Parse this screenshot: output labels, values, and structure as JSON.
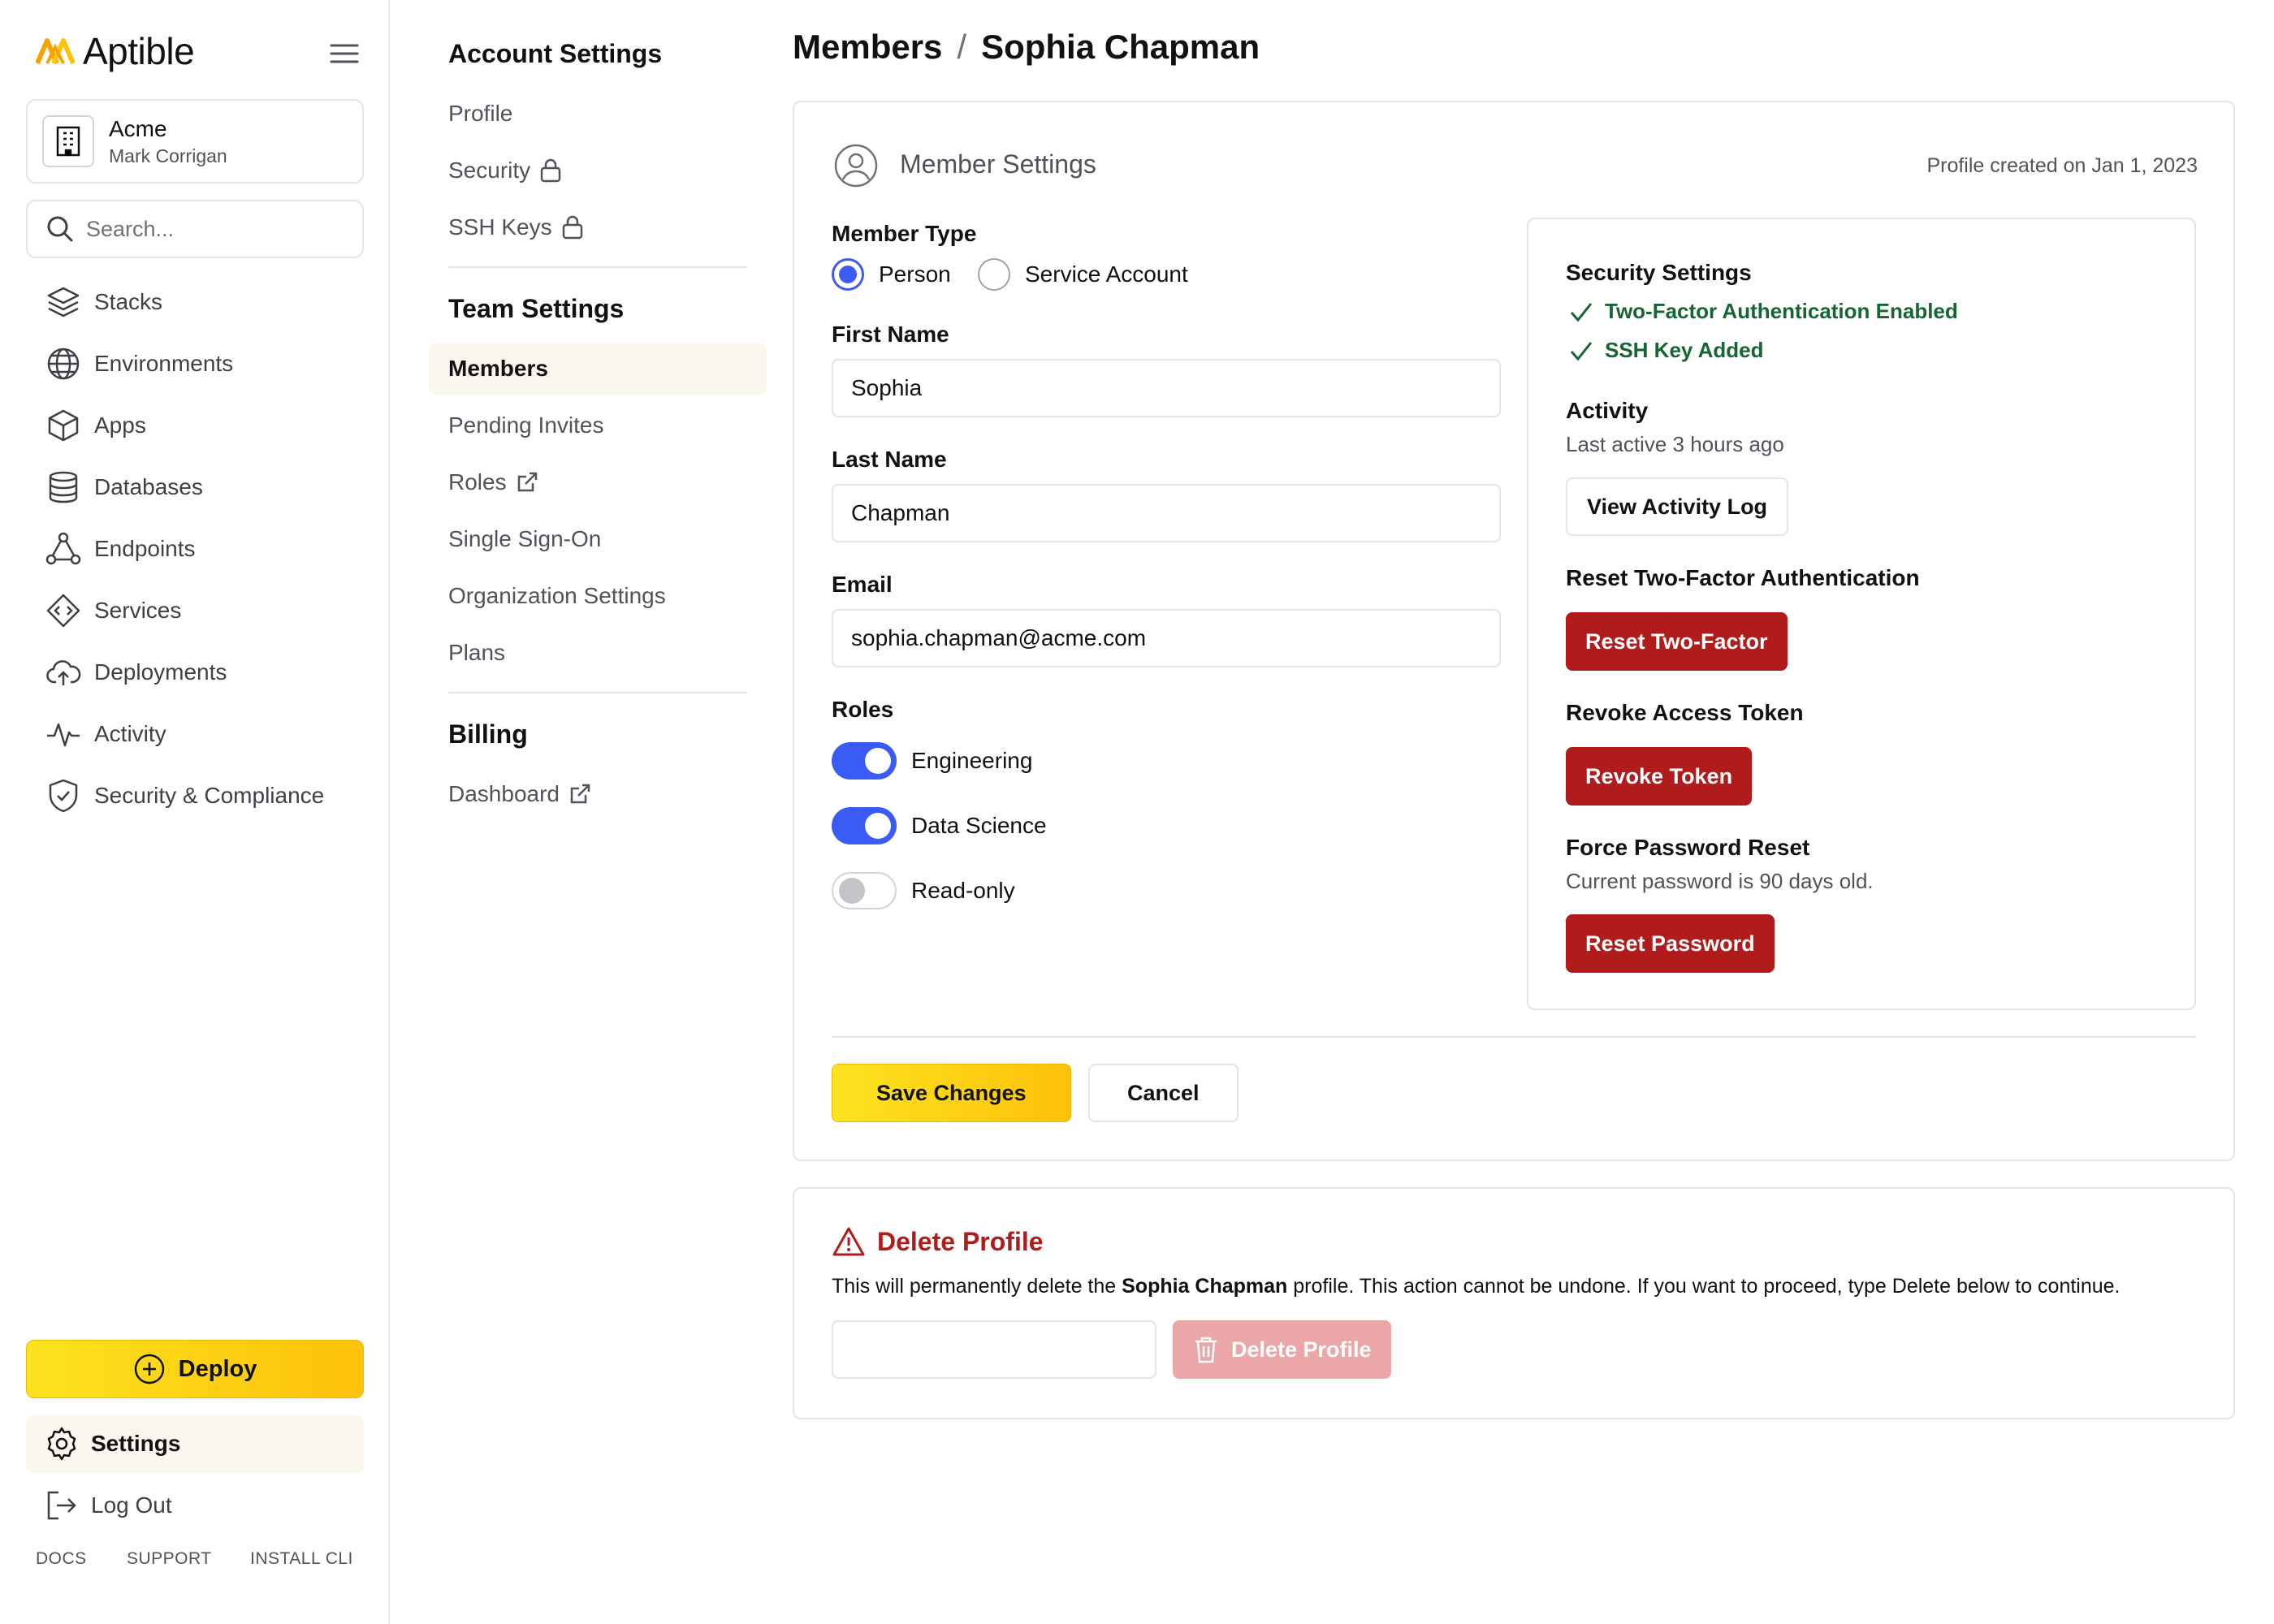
{
  "brand": {
    "name": "Aptible",
    "accent": "#fdc10a",
    "logo_icon": "aptible-chevrons-icon"
  },
  "org": {
    "name": "Acme",
    "user": "Mark Corrigan"
  },
  "search": {
    "placeholder": "Search..."
  },
  "sidebar": {
    "items": [
      {
        "label": "Stacks",
        "icon": "layers-icon"
      },
      {
        "label": "Environments",
        "icon": "globe-icon"
      },
      {
        "label": "Apps",
        "icon": "cube-icon"
      },
      {
        "label": "Databases",
        "icon": "database-icon"
      },
      {
        "label": "Endpoints",
        "icon": "endpoints-icon"
      },
      {
        "label": "Services",
        "icon": "code-diamond-icon"
      },
      {
        "label": "Deployments",
        "icon": "cloud-upload-icon"
      },
      {
        "label": "Activity",
        "icon": "pulse-icon"
      },
      {
        "label": "Security & Compliance",
        "icon": "shield-check-icon"
      }
    ],
    "deploy_label": "Deploy",
    "settings_label": "Settings",
    "logout_label": "Log Out",
    "footer": [
      "DOCS",
      "SUPPORT",
      "INSTALL CLI"
    ]
  },
  "settings_nav": {
    "account_title": "Account Settings",
    "account_items": [
      {
        "label": "Profile"
      },
      {
        "label": "Security",
        "icon": "lock-icon"
      },
      {
        "label": "SSH Keys",
        "icon": "lock-icon"
      }
    ],
    "team_title": "Team Settings",
    "team_items": [
      {
        "label": "Members",
        "active": true
      },
      {
        "label": "Pending Invites"
      },
      {
        "label": "Roles",
        "icon": "external-link-icon"
      },
      {
        "label": "Single Sign-On"
      },
      {
        "label": "Organization Settings"
      },
      {
        "label": "Plans"
      }
    ],
    "billing_title": "Billing",
    "billing_items": [
      {
        "label": "Dashboard",
        "icon": "external-link-icon"
      }
    ]
  },
  "breadcrumb": {
    "parent": "Members",
    "separator": "/",
    "current": "Sophia Chapman"
  },
  "member_settings": {
    "title": "Member Settings",
    "created": "Profile created on Jan 1, 2023",
    "member_type_label": "Member Type",
    "member_type_options": [
      "Person",
      "Service Account"
    ],
    "member_type_selected": "Person",
    "first_name_label": "First Name",
    "first_name": "Sophia",
    "last_name_label": "Last Name",
    "last_name": "Chapman",
    "email_label": "Email",
    "email": "sophia.chapman@acme.com",
    "roles_label": "Roles",
    "roles": [
      {
        "label": "Engineering",
        "enabled": true
      },
      {
        "label": "Data Science",
        "enabled": true
      },
      {
        "label": "Read-only",
        "enabled": false
      }
    ]
  },
  "security_panel": {
    "title": "Security Settings",
    "checks": [
      "Two-Factor Authentication Enabled",
      "SSH Key Added"
    ],
    "activity_title": "Activity",
    "activity_text": "Last active 3 hours ago",
    "activity_button": "View Activity Log",
    "reset_2fa_title": "Reset Two-Factor Authentication",
    "reset_2fa_button": "Reset Two-Factor",
    "revoke_title": "Revoke Access Token",
    "revoke_button": "Revoke Token",
    "password_title": "Force Password Reset",
    "password_text": "Current password is 90 days old.",
    "password_button": "Reset Password"
  },
  "actions": {
    "save": "Save Changes",
    "cancel": "Cancel"
  },
  "delete_profile": {
    "title": "Delete Profile",
    "text_before": "This will permanently delete the ",
    "text_name": "Sophia Chapman",
    "text_after": " profile. This action cannot be undone. If you want to proceed, type Delete below to continue.",
    "input_value": "",
    "button": "Delete Profile"
  },
  "colors": {
    "primary_blue": "#3b5bf6",
    "danger_red": "#b01c1c",
    "success_green": "#166534",
    "highlight_bg": "#fbf6ee"
  }
}
